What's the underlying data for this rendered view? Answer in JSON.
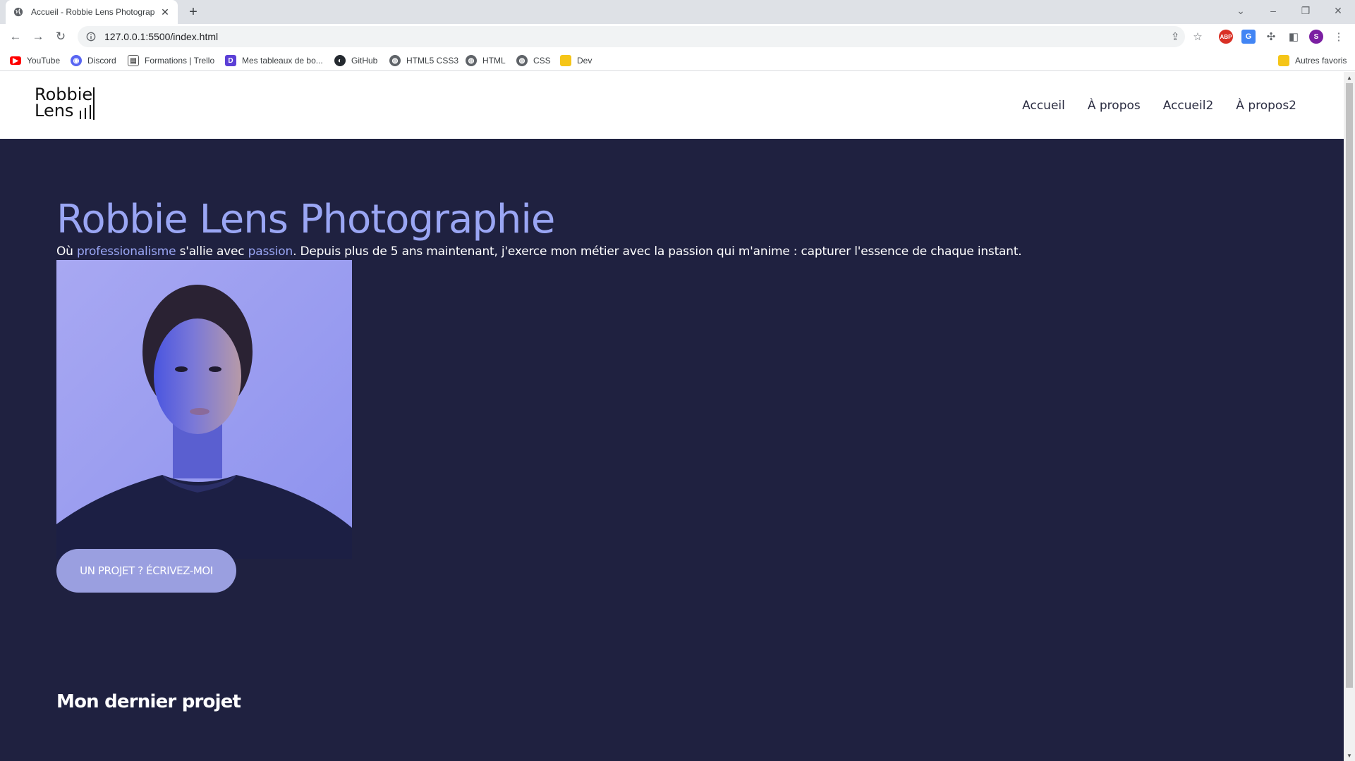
{
  "browser": {
    "tab_title": "Accueil - Robbie Lens Photograp",
    "url": "127.0.0.1:5500/index.html",
    "bookmarks": [
      {
        "label": "YouTube",
        "icon": "youtube-icon",
        "color": "#ff0000"
      },
      {
        "label": "Discord",
        "icon": "discord-icon",
        "color": "#5865f2"
      },
      {
        "label": "Formations | Trello",
        "icon": "trello-icon",
        "color": "#555555"
      },
      {
        "label": "Mes tableaux de bo...",
        "icon": "board-icon",
        "color": "#5b3fd6"
      },
      {
        "label": "GitHub",
        "icon": "github-icon",
        "color": "#24292f"
      },
      {
        "label": "HTML5 CSS3",
        "icon": "globe-icon",
        "color": "#5f6368"
      },
      {
        "label": "HTML",
        "icon": "globe-icon",
        "color": "#5f6368"
      },
      {
        "label": "CSS",
        "icon": "globe-icon",
        "color": "#5f6368"
      },
      {
        "label": "Dev",
        "icon": "folder-icon",
        "color": "#f5c518"
      }
    ],
    "other_bookmarks": "Autres favoris",
    "profile_initial": "S",
    "extension_abp": "ABP"
  },
  "site": {
    "logo_line1": "Robbie",
    "logo_line2": "Lens",
    "nav": [
      "Accueil",
      "À propos",
      "Accueil2",
      "À propos2"
    ],
    "hero_title": "Robbie Lens Photographie",
    "intro": {
      "p1": "Où ",
      "hl1": "professionalisme",
      "p2": " s'allie avec ",
      "hl2": "passion",
      "p3": ". Depuis plus de 5 ans maintenant, j'exerce mon métier avec la passion qui m'anime : capturer l'essence de chaque instant."
    },
    "cta": "UN PROJET ? ÉCRIVEZ-MOI",
    "section_title": "Mon dernier projet"
  },
  "colors": {
    "accent": "#9aa6f4",
    "hero_bg": "#1f2140",
    "cta_bg": "#9a9fe0"
  }
}
